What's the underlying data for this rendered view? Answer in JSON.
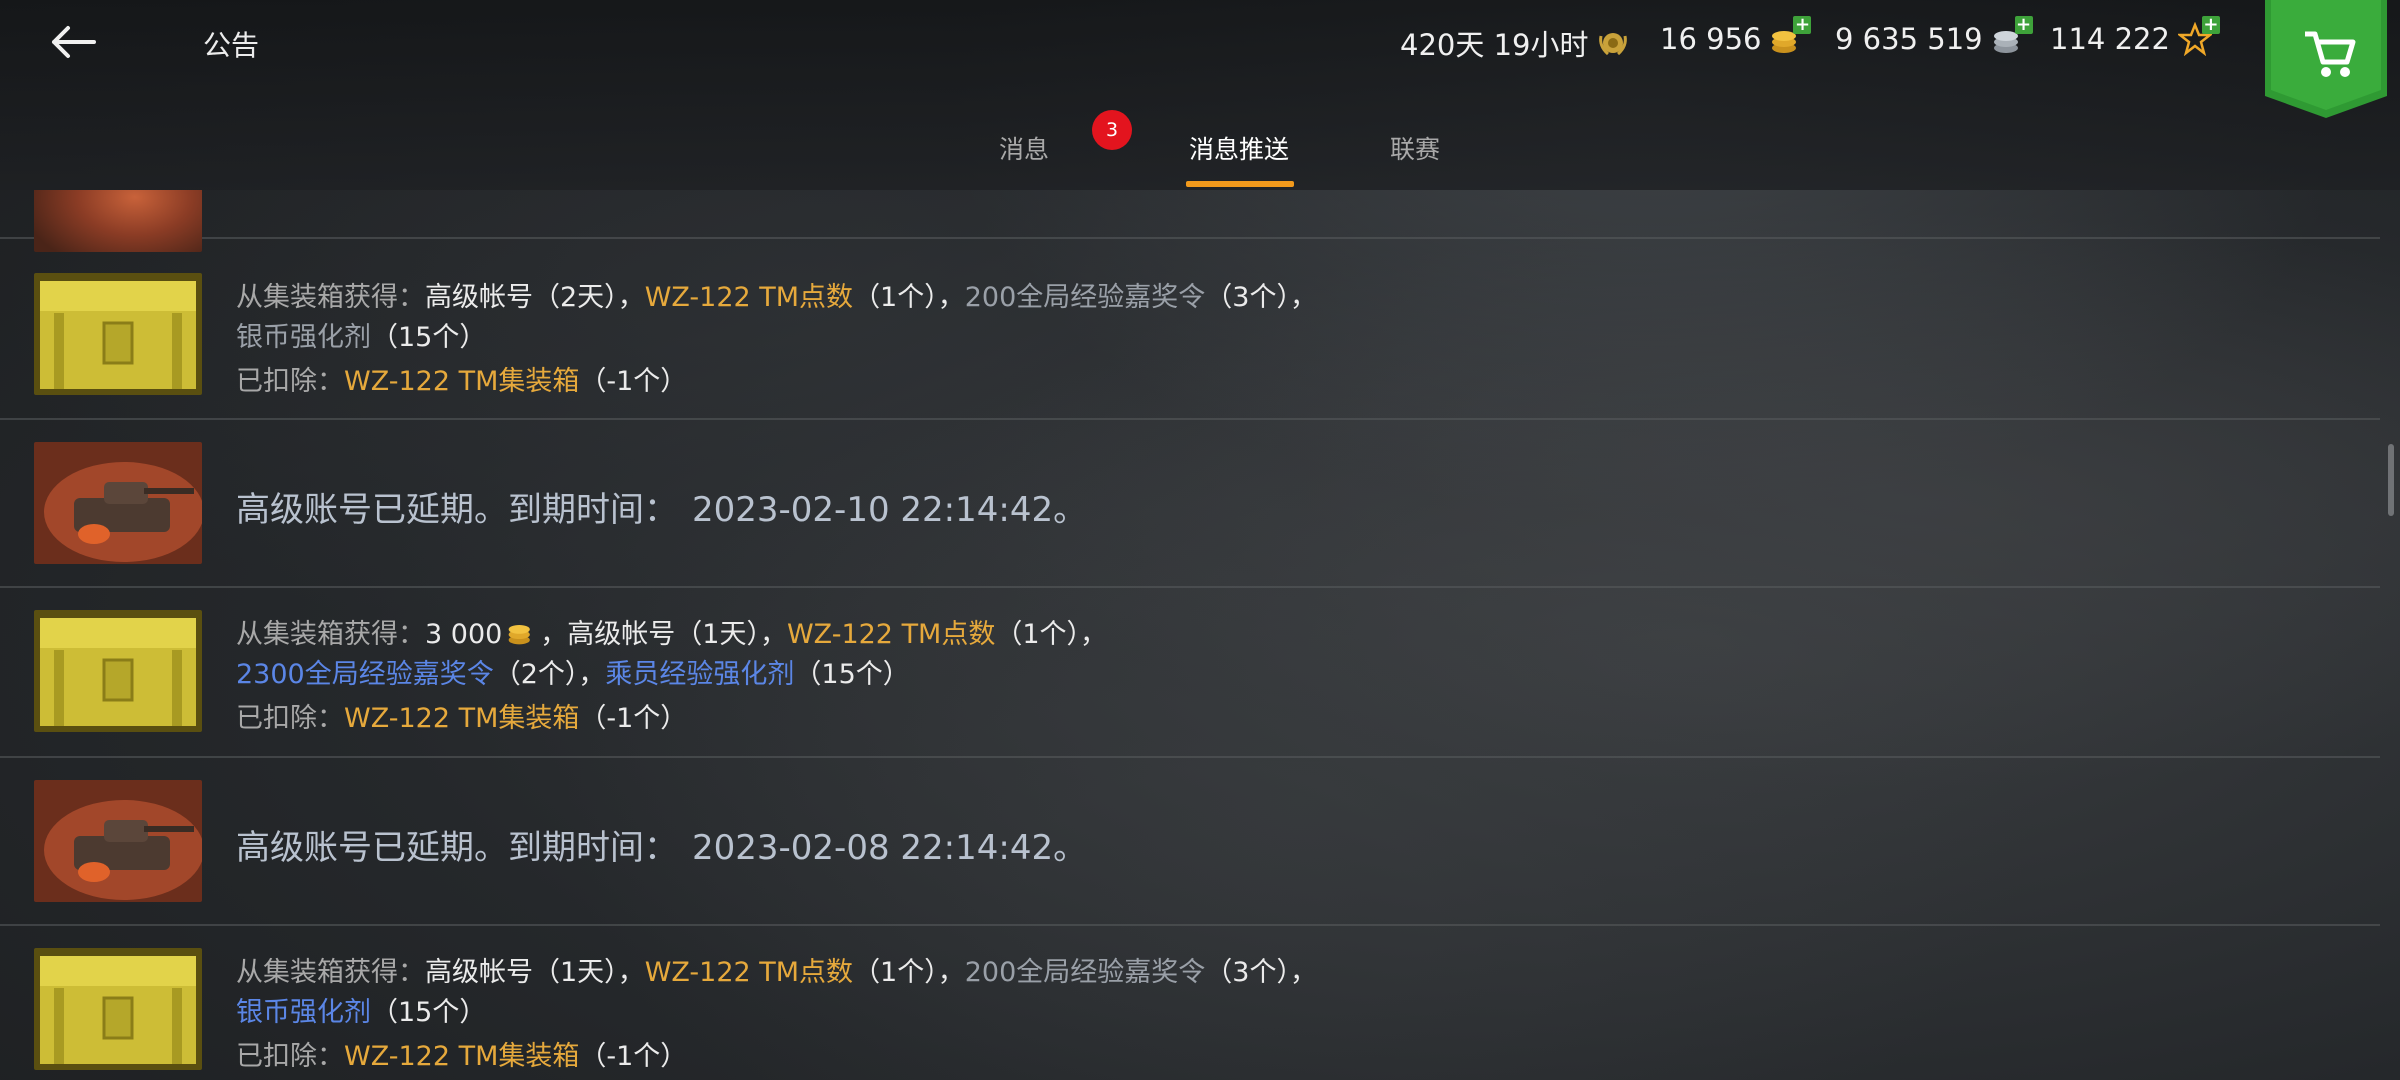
{
  "header": {
    "title": "公告",
    "premium_time": "420天 19小时",
    "gold": "16 956",
    "credits": "9 635 519",
    "free_xp": "114 222"
  },
  "tabs": [
    {
      "label": "消息"
    },
    {
      "label": "消息推送"
    },
    {
      "label": "联赛"
    }
  ],
  "badge_count": "3",
  "messages": [
    {
      "type": "crate",
      "line1": [
        {
          "t": "从集装箱获得：",
          "c": "lbl"
        },
        {
          "t": "高级帐号（2天）",
          "c": ""
        },
        {
          "t": "，",
          "c": ""
        },
        {
          "t": "WZ-122 TM点数",
          "c": "gold"
        },
        {
          "t": "（1个）",
          "c": ""
        },
        {
          "t": "，",
          "c": ""
        },
        {
          "t": "200全局经验嘉奖令",
          "c": "gray"
        },
        {
          "t": "（3个）",
          "c": ""
        },
        {
          "t": "，",
          "c": ""
        }
      ],
      "line2": [
        {
          "t": "银币强化剂",
          "c": "gray"
        },
        {
          "t": "（15个）",
          "c": ""
        }
      ],
      "line3": [
        {
          "t": "已扣除：",
          "c": "lbl"
        },
        {
          "t": "WZ-122 TM集装箱",
          "c": "gold"
        },
        {
          "t": "（-1个）",
          "c": ""
        }
      ]
    },
    {
      "type": "premium",
      "text": "高级账号已延期。到期时间：",
      "date": "2023-02-10 22:14:42。"
    },
    {
      "type": "crate",
      "line1": [
        {
          "t": "从集装箱获得：",
          "c": "lbl"
        },
        {
          "t": "3 000",
          "c": ""
        },
        {
          "t": "，",
          "c": ""
        },
        {
          "t": "高级帐号（1天）",
          "c": ""
        },
        {
          "t": "，",
          "c": ""
        },
        {
          "t": "WZ-122 TM点数",
          "c": "gold"
        },
        {
          "t": "（1个）",
          "c": ""
        },
        {
          "t": "，",
          "c": ""
        }
      ],
      "line2": [
        {
          "t": "2300全局经验嘉奖令",
          "c": "blue"
        },
        {
          "t": "（2个）",
          "c": ""
        },
        {
          "t": "，",
          "c": ""
        },
        {
          "t": "乘员经验强化剂",
          "c": "blue"
        },
        {
          "t": "（15个）",
          "c": ""
        }
      ],
      "line3": [
        {
          "t": "已扣除：",
          "c": "lbl"
        },
        {
          "t": "WZ-122 TM集装箱",
          "c": "gold"
        },
        {
          "t": "（-1个）",
          "c": ""
        }
      ]
    },
    {
      "type": "premium",
      "text": "高级账号已延期。到期时间：",
      "date": "2023-02-08 22:14:42。"
    },
    {
      "type": "crate",
      "line1": [
        {
          "t": "从集装箱获得：",
          "c": "lbl"
        },
        {
          "t": "高级帐号（1天）",
          "c": ""
        },
        {
          "t": "，",
          "c": ""
        },
        {
          "t": "WZ-122 TM点数",
          "c": "gold"
        },
        {
          "t": "（1个）",
          "c": ""
        },
        {
          "t": "，",
          "c": ""
        },
        {
          "t": "200全局经验嘉奖令",
          "c": "gray"
        },
        {
          "t": "（3个）",
          "c": ""
        },
        {
          "t": "，",
          "c": ""
        }
      ],
      "line2": [
        {
          "t": "银币强化剂",
          "c": "blue"
        },
        {
          "t": "（15个）",
          "c": ""
        }
      ],
      "line3": [
        {
          "t": "已扣除：",
          "c": "lbl"
        },
        {
          "t": "WZ-122 TM集装箱",
          "c": "gold"
        },
        {
          "t": "（-1个）",
          "c": ""
        }
      ]
    }
  ],
  "icons": {
    "back": "back-arrow-icon",
    "premium": "laurel-medal-icon",
    "gold": "gold-coins-icon",
    "credits": "silver-coins-icon",
    "free_xp": "star-icon",
    "cart": "cart-icon"
  },
  "colors": {
    "tab_underline": "#f29a1c",
    "badge": "#e3141e",
    "gold_text": "#e6a93c",
    "blue_text": "#5b86e6",
    "cart_green": "#2f9a33"
  }
}
